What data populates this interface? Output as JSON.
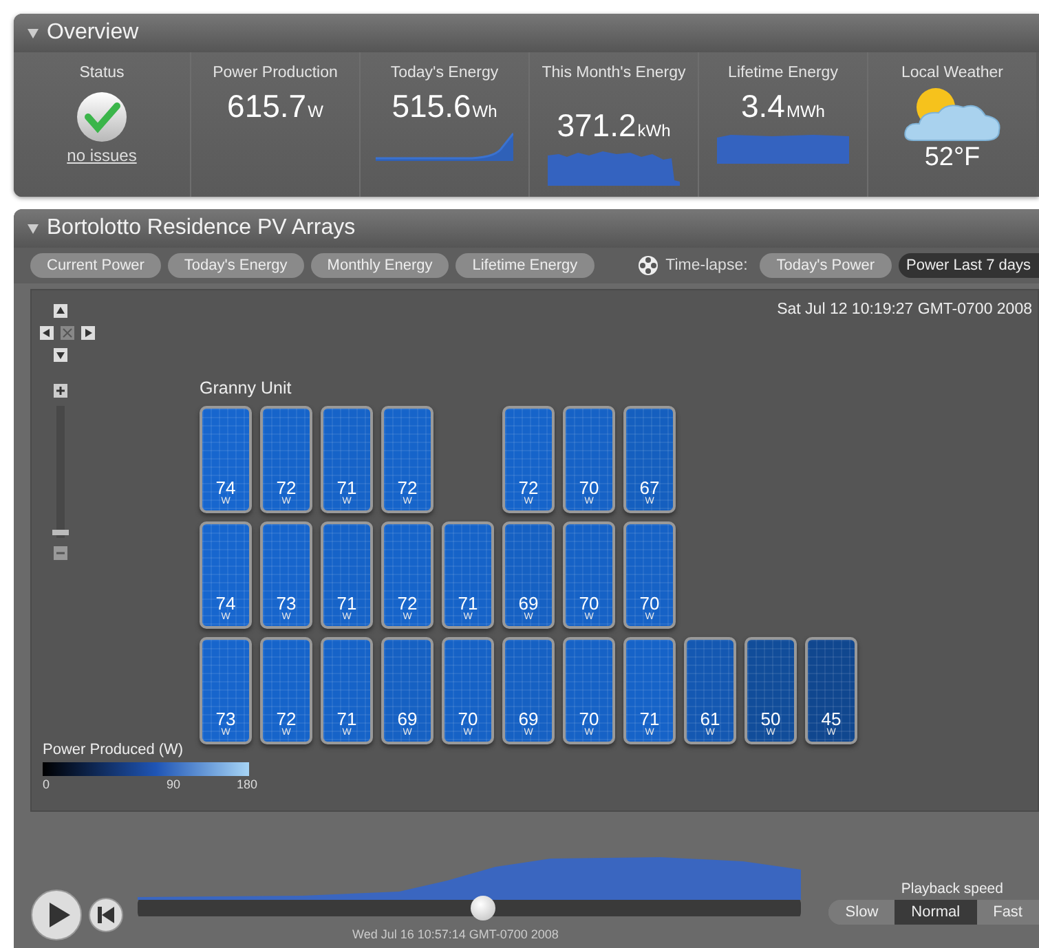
{
  "overview": {
    "title": "Overview",
    "metrics": [
      {
        "kind": "status",
        "label": "Status",
        "link": "no issues"
      },
      {
        "kind": "value",
        "label": "Power Production",
        "value": "615.7",
        "unit": "W"
      },
      {
        "kind": "trend",
        "label": "Today's Energy",
        "value": "515.6",
        "unit": "Wh"
      },
      {
        "kind": "bars",
        "label": "This Month's Energy",
        "value": "371.2",
        "unit": "kWh"
      },
      {
        "kind": "block",
        "label": "Lifetime Energy",
        "value": "3.4",
        "unit": "MWh"
      },
      {
        "kind": "weather",
        "label": "Local Weather",
        "temperature": "52°F"
      }
    ]
  },
  "arrays": {
    "title": "Bortolotto Residence PV Arrays",
    "views": [
      {
        "label": "Current Power",
        "selected": false
      },
      {
        "label": "Today's Energy",
        "selected": false
      },
      {
        "label": "Monthly Energy",
        "selected": false
      },
      {
        "label": "Lifetime Energy",
        "selected": false
      }
    ],
    "timelapse": {
      "label": "Time-lapse:",
      "options": [
        {
          "label": "Today's Power",
          "selected": false
        },
        {
          "label": "Power Last 7 days",
          "selected": true
        }
      ]
    },
    "timestamp": "Sat Jul 12 10:19:27 GMT-0700 2008",
    "zoom": {
      "level": 0.02
    },
    "group_label": "Granny Unit",
    "rows": [
      {
        "panels": [
          {
            "kind": "panel",
            "watts": "74",
            "unit": "W"
          },
          {
            "kind": "panel",
            "watts": "72",
            "unit": "W"
          },
          {
            "kind": "panel",
            "watts": "71",
            "unit": "W"
          },
          {
            "kind": "panel",
            "watts": "72",
            "unit": "W"
          },
          {
            "kind": "gap"
          },
          {
            "kind": "panel",
            "watts": "72",
            "unit": "W"
          },
          {
            "kind": "panel",
            "watts": "70",
            "unit": "W"
          },
          {
            "kind": "panel",
            "watts": "67",
            "unit": "W"
          }
        ]
      },
      {
        "panels": [
          {
            "kind": "panel",
            "watts": "74",
            "unit": "W"
          },
          {
            "kind": "panel",
            "watts": "73",
            "unit": "W"
          },
          {
            "kind": "panel",
            "watts": "71",
            "unit": "W"
          },
          {
            "kind": "panel",
            "watts": "72",
            "unit": "W"
          },
          {
            "kind": "panel",
            "watts": "71",
            "unit": "W"
          },
          {
            "kind": "panel",
            "watts": "69",
            "unit": "W"
          },
          {
            "kind": "panel",
            "watts": "70",
            "unit": "W"
          },
          {
            "kind": "panel",
            "watts": "70",
            "unit": "W"
          }
        ]
      },
      {
        "panels": [
          {
            "kind": "panel",
            "watts": "73",
            "unit": "W"
          },
          {
            "kind": "panel",
            "watts": "72",
            "unit": "W"
          },
          {
            "kind": "panel",
            "watts": "71",
            "unit": "W"
          },
          {
            "kind": "panel",
            "watts": "69",
            "unit": "W"
          },
          {
            "kind": "panel",
            "watts": "70",
            "unit": "W"
          },
          {
            "kind": "panel",
            "watts": "69",
            "unit": "W"
          },
          {
            "kind": "panel",
            "watts": "70",
            "unit": "W"
          },
          {
            "kind": "panel",
            "watts": "71",
            "unit": "W"
          },
          {
            "kind": "panel",
            "watts": "61",
            "unit": "W"
          },
          {
            "kind": "panel",
            "watts": "50",
            "unit": "W"
          },
          {
            "kind": "panel",
            "watts": "45",
            "unit": "W"
          }
        ]
      }
    ],
    "legend": {
      "title": "Power Produced (W)",
      "ticks": [
        "0",
        "90",
        "180"
      ]
    }
  },
  "playback": {
    "position": {
      "level": 0.52
    },
    "time": "Wed Jul 16 10:57:14 GMT-0700 2008",
    "speed_label": "Playback speed",
    "speeds": [
      {
        "label": "Slow",
        "selected": false
      },
      {
        "label": "Normal",
        "selected": true
      },
      {
        "label": "Fast",
        "selected": false
      }
    ]
  }
}
